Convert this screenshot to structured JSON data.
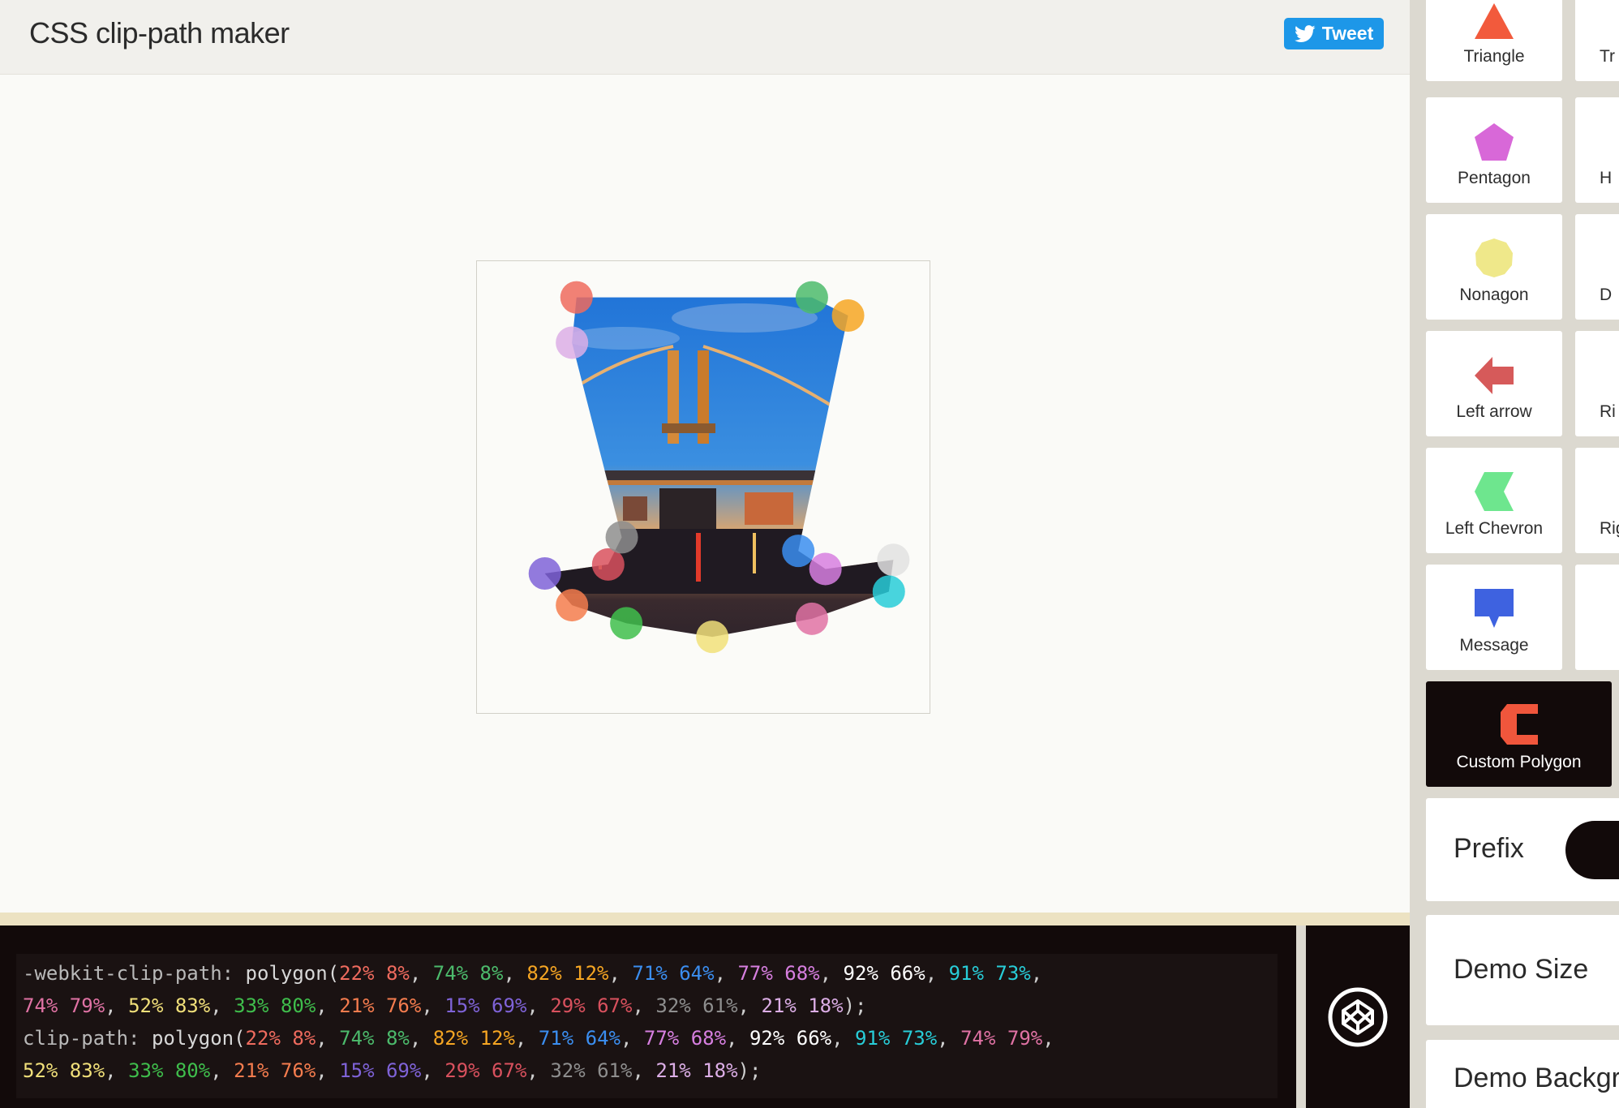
{
  "header": {
    "title": "CSS clip-path maker",
    "tweet_label": "Tweet",
    "tweet_color": "#1d97e8"
  },
  "demo": {
    "image_description_icon": "bridge-photo",
    "polygon_points": [
      [
        22,
        8
      ],
      [
        74,
        8
      ],
      [
        82,
        12
      ],
      [
        71,
        64
      ],
      [
        77,
        68
      ],
      [
        92,
        66
      ],
      [
        91,
        73
      ],
      [
        74,
        79
      ],
      [
        52,
        83
      ],
      [
        33,
        80
      ],
      [
        21,
        76
      ],
      [
        15,
        69
      ],
      [
        29,
        67
      ],
      [
        32,
        61
      ],
      [
        21,
        18
      ]
    ],
    "handle_colors": [
      "#ef6b5e",
      "#4cbb6c",
      "#f6a623",
      "#3b8ef0",
      "#d77fe0",
      "#e2e2e2",
      "#28cdd8",
      "#e072a4",
      "#f1e07a",
      "#3fbe4c",
      "#f47c4e",
      "#7f63d8",
      "#d9515e",
      "#8e8e8e",
      "#dcaee6"
    ]
  },
  "code": {
    "webkit_prop": "-webkit-clip-path:",
    "prop": "clip-path:",
    "fn_open": "polygon(",
    "fn_close": ");",
    "point_texts": [
      "22% 8%",
      "74% 8%",
      "82% 12%",
      "71% 64%",
      "77% 68%",
      "92% 66%",
      "91% 73%",
      "74% 79%",
      "52% 83%",
      "33% 80%",
      "21% 76%",
      "15% 69%",
      "29% 67%",
      "32% 61%",
      "21% 18%"
    ],
    "point_colors": [
      "#ef6b5e",
      "#4cbb6c",
      "#f6a623",
      "#3b8ef0",
      "#d77fe0",
      "#ffffff",
      "#28cdd8",
      "#e072a4",
      "#f1e07a",
      "#3fbe4c",
      "#f47c4e",
      "#7f63d8",
      "#d9515e",
      "#8e8e8e",
      "#dcaee6"
    ]
  },
  "sidebar": {
    "shapes": [
      {
        "label": "Triangle",
        "icon": "triangle-icon",
        "color": "#f25a3c"
      },
      {
        "label": "Pentagon",
        "icon": "pentagon-icon",
        "color": "#d868d8"
      },
      {
        "label": "Nonagon",
        "icon": "nonagon-icon",
        "color": "#efe88a"
      },
      {
        "label": "Left arrow",
        "icon": "left-arrow-icon",
        "color": "#d65a5a"
      },
      {
        "label": "Left Chevron",
        "icon": "left-chevron-icon",
        "color": "#6ee68e"
      },
      {
        "label": "Message",
        "icon": "message-icon",
        "color": "#3e62e0"
      },
      {
        "label": "Custom Polygon",
        "icon": "custom-polygon-icon",
        "color": "#f0563c"
      }
    ],
    "partial_shapes": [
      "Tr",
      "H",
      "D",
      "Ri",
      "Righ",
      ""
    ],
    "settings": {
      "prefix_label": "Prefix",
      "demo_size_label": "Demo Size",
      "demo_background_label": "Demo Backgro"
    }
  }
}
